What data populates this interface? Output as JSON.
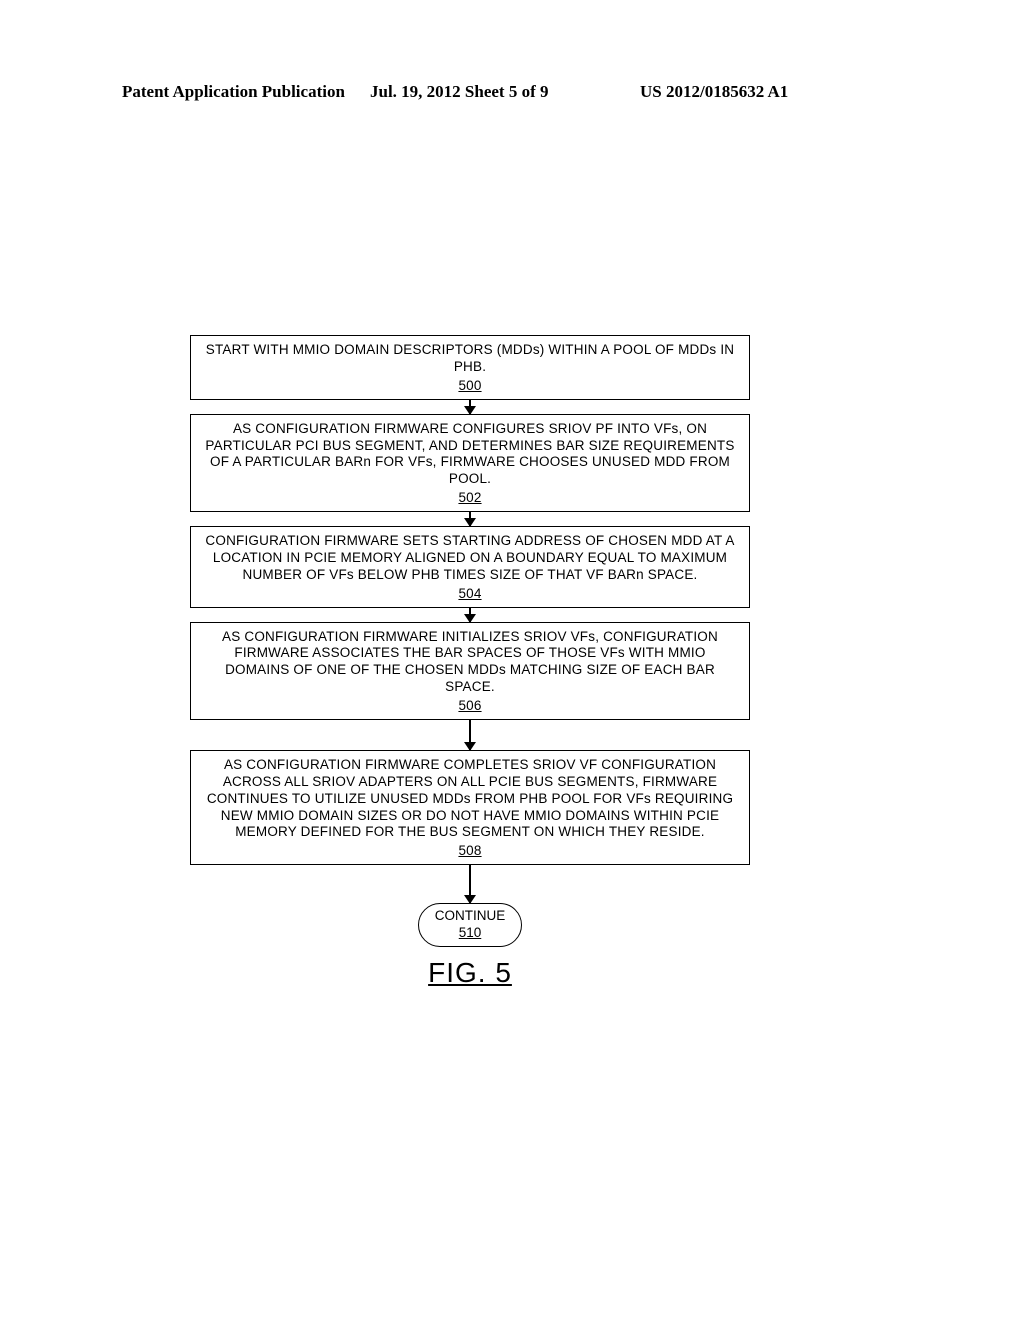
{
  "header": {
    "left": "Patent Application Publication",
    "center": "Jul. 19, 2012  Sheet 5 of 9",
    "right": "US 2012/0185632 A1"
  },
  "flow": {
    "box500": {
      "text": "START WITH MMIO DOMAIN DESCRIPTORS (MDDs) WITHIN A POOL OF MDDs IN PHB.",
      "ref": "500"
    },
    "box502": {
      "text": "AS CONFIGURATION FIRMWARE CONFIGURES SRIOV PF INTO VFs, ON PARTICULAR PCI BUS SEGMENT, AND DETERMINES BAR SIZE REQUIREMENTS OF A PARTICULAR BARn FOR VFs, FIRMWARE CHOOSES UNUSED MDD FROM POOL.",
      "ref": "502"
    },
    "box504": {
      "text": "CONFIGURATION FIRMWARE SETS STARTING ADDRESS OF CHOSEN MDD AT A LOCATION IN PCIE MEMORY ALIGNED ON A BOUNDARY EQUAL TO MAXIMUM NUMBER OF VFs BELOW PHB TIMES SIZE OF THAT VF BARn SPACE.",
      "ref": "504"
    },
    "box506": {
      "text": "AS CONFIGURATION FIRMWARE INITIALIZES SRIOV VFs, CONFIGURATION FIRMWARE ASSOCIATES THE BAR SPACES OF THOSE VFs WITH MMIO DOMAINS OF ONE OF THE CHOSEN MDDs MATCHING SIZE OF EACH BAR SPACE.",
      "ref": "506"
    },
    "box508": {
      "text": "AS CONFIGURATION FIRMWARE COMPLETES SRIOV VF CONFIGURATION ACROSS ALL SRIOV ADAPTERS ON ALL PCIE BUS SEGMENTS, FIRMWARE CONTINUES TO UTILIZE UNUSED MDDs FROM PHB POOL FOR VFs REQUIRING NEW MMIO DOMAIN SIZES OR DO NOT HAVE MMIO DOMAINS WITHIN PCIE MEMORY DEFINED FOR THE BUS SEGMENT ON WHICH THEY RESIDE.",
      "ref": "508"
    },
    "terminator": {
      "text": "CONTINUE",
      "ref": "510"
    }
  },
  "figure_label": "FIG. 5"
}
